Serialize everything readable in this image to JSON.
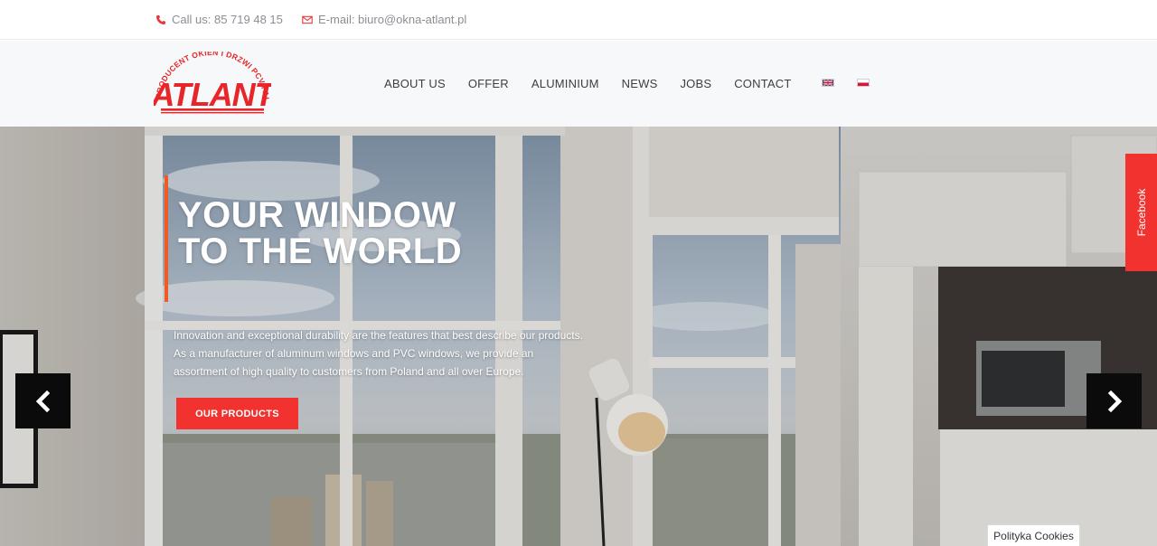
{
  "topbar": {
    "phone": "Call us: 85 719 48 15",
    "email": "E-mail: biuro@okna-atlant.pl"
  },
  "logo": {
    "name": "ATLANT",
    "tagline": "PRODUCENT OKIEN I DRZWI PCV I ALU",
    "color": "#e8262a"
  },
  "nav": {
    "items": [
      "ABOUT US",
      "OFFER",
      "ALUMINIUM",
      "NEWS",
      "JOBS",
      "CONTACT"
    ]
  },
  "languages": [
    "English",
    "Polski"
  ],
  "hero": {
    "title_line1": "YOUR WINDOW",
    "title_line2": "TO THE WORLD",
    "description": "Innovation and exceptional durability are the features that best describe our products. As a manufacturer of aluminum windows and PVC windows, we provide an assortment of high quality to customers from Poland and all over Europe.",
    "cta_label": "OUR PRODUCTS",
    "accent_color": "#f05a23",
    "cta_color": "#f2322e"
  },
  "slider": {
    "prev_icon": "chevron-left-icon",
    "next_icon": "chevron-right-icon"
  },
  "facebook_tab": {
    "label": "Facebook"
  },
  "cookies": {
    "label": "Polityka Cookies"
  }
}
